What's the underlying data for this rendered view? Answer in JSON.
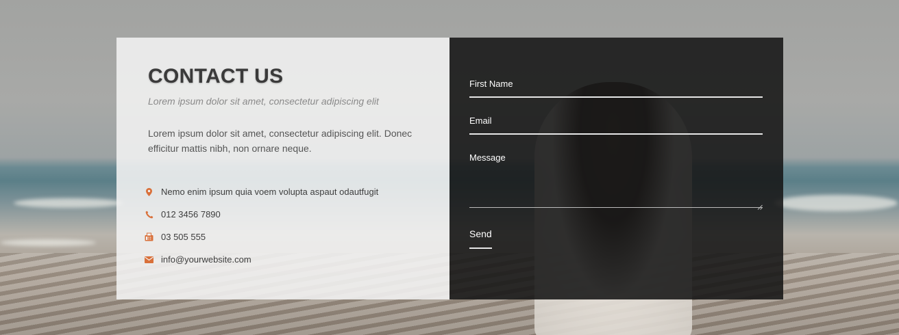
{
  "contact": {
    "title": "CONTACT US",
    "subtitle": "Lorem ipsum dolor sit amet, consectetur adipiscing elit",
    "description": "Lorem ipsum dolor sit amet, consectetur adipiscing elit. Donec efficitur mattis nibh, non ornare neque.",
    "info": [
      {
        "icon": "map-marker-icon",
        "text": "Nemo enim ipsum quia voem volupta aspaut odautfugit"
      },
      {
        "icon": "phone-icon",
        "text": "012 3456 7890"
      },
      {
        "icon": "fax-icon",
        "text": "03 505 555"
      },
      {
        "icon": "envelope-icon",
        "text": "info@yourwebsite.com"
      }
    ]
  },
  "form": {
    "first_name_label": "First Name",
    "first_name_value": "",
    "email_label": "Email",
    "email_value": "",
    "message_label": "Message",
    "message_value": "",
    "send_label": "Send"
  },
  "colors": {
    "accent": "#d9703a",
    "left_panel": "#f2f2f2",
    "right_panel": "#161616"
  }
}
